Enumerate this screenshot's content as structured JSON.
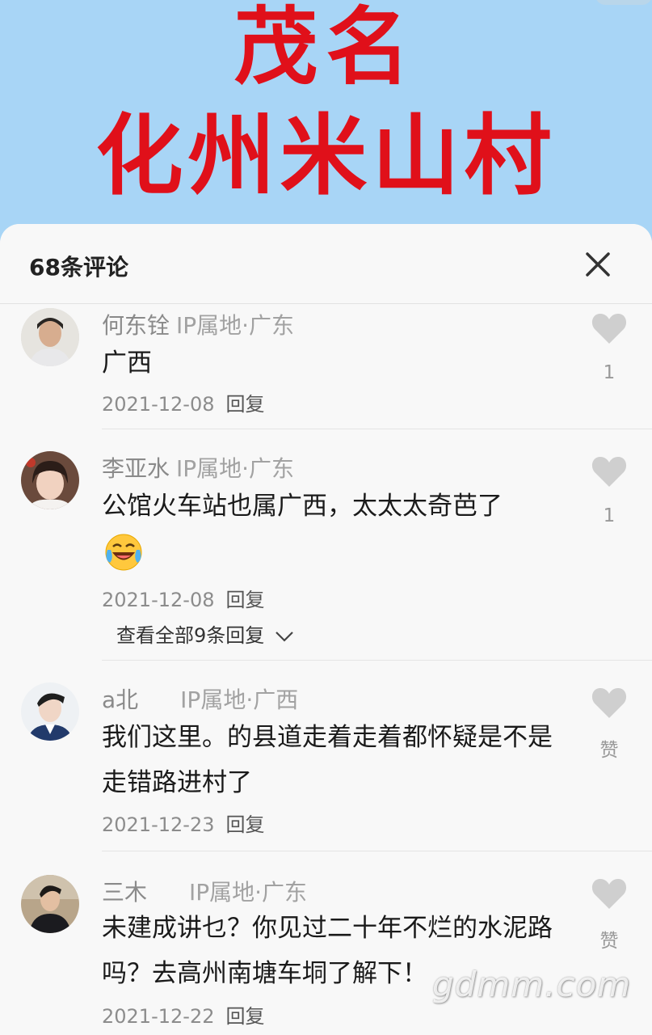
{
  "hero": {
    "line1": "茂名",
    "line2": "化州米山村"
  },
  "header": {
    "comment_count": "68条评论"
  },
  "comments": [
    {
      "name": "何东铨",
      "ip": "IP属地·广东",
      "text": "广西",
      "date": "2021-12-08",
      "reply": "回复",
      "likes": "1"
    },
    {
      "name": "李亚水",
      "ip": "IP属地·广东",
      "text": "公馆火车站也属广西，太太太奇芭了",
      "emoji": "face-with-tears-of-joy",
      "date": "2021-12-08",
      "reply": "回复",
      "likes": "1",
      "view_replies": "查看全部9条回复"
    },
    {
      "name": "a北",
      "ip": "IP属地·广西",
      "text": "我们这里。的县道走着走着都怀疑是不是走错路进村了",
      "date": "2021-12-23",
      "reply": "回复",
      "likes": "赞"
    },
    {
      "name": "三木",
      "ip": "IP属地·广东",
      "text": "未建成讲乜？你见过二十年不烂的水泥路吗？去高州南塘车垌了解下！",
      "date": "2021-12-22",
      "reply": "回复",
      "likes": "赞"
    }
  ],
  "icons": {
    "close": "close-icon",
    "like": "heart-icon",
    "chevron": "chevron-down-icon"
  },
  "colors": {
    "hero_bg": "#a8d5f6",
    "hero_text": "#e0101a",
    "sheet_bg": "#f8f8f8"
  },
  "watermark": "gdmm.com"
}
